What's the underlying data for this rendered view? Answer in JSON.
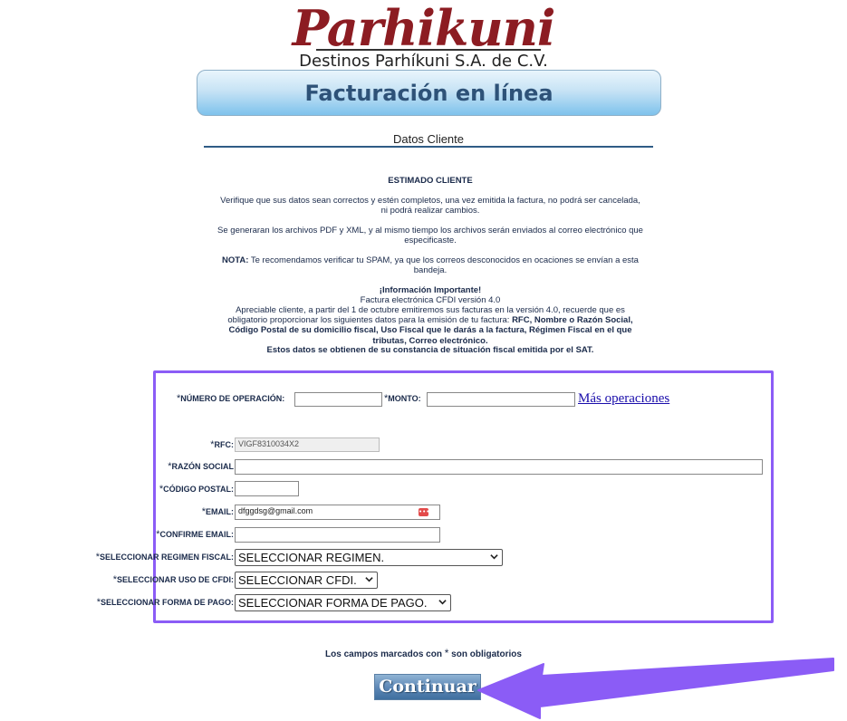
{
  "header": {
    "logo_text": "Parhikuni",
    "company": "Destinos Parhíkuni S.A. de C.V.",
    "banner_title": "Facturación en línea",
    "section_title": "Datos Cliente"
  },
  "info": {
    "heading": "ESTIMADO CLIENTE",
    "p1": "Verifique que sus datos sean correctos y estén completos, una vez emitida la factura, no podrá ser cancelada, ni podrá realizar cambios.",
    "p2": "Se generaran los archivos PDF y XML, y al mismo tiempo los archivos serán enviados al correo electrónico que especificaste.",
    "nota_label": "NOTA:",
    "nota_text": " Te recomendamos verificar tu SPAM, ya que los correos desconocidos en ocaciones se envían a esta bandeja.",
    "important_title": "¡Información Importante!",
    "important_version": "Factura electrónica CFDI versión 4.0",
    "important_intro": "Apreciable cliente, a partir del 1 de octubre emitiremos sus facturas en la versión 4.0, recuerde que es obligatorio proporcionar los siguientes datos para la emisión de tu factura: ",
    "important_fields": "RFC, Nombre o Razón Social, Código Postal de su domicilio fiscal, Uso Fiscal que le darás a la factura, Régimen Fiscal en el que tributas, Correo electrónico.",
    "important_source": "Estos datos se obtienen de su constancia de situación fiscal emitida por el SAT."
  },
  "form": {
    "asterisk": "*",
    "numero_operacion_label": "NÚMERO DE OPERACIÓN:",
    "numero_operacion_value": "",
    "monto_label": "MONTO:",
    "monto_value": "",
    "mas_operaciones": "Más operaciones",
    "rfc_label": "RFC:",
    "rfc_value": "VIGF8310034X2",
    "razon_social_label": "RAZÓN SOCIAL",
    "razon_social_value": "",
    "codigo_postal_label": "CÓDIGO POSTAL:",
    "codigo_postal_value": "",
    "email_label": "EMAIL:",
    "email_value": "dfggdsg@gmail.com",
    "confirme_email_label": "CONFIRME EMAIL:",
    "confirme_email_value": "",
    "regimen_label": "SELECCIONAR REGIMEN FISCAL:",
    "regimen_value": "SELECCIONAR REGIMEN.",
    "uso_cfdi_label": "SELECCIONAR USO DE CFDI:",
    "uso_cfdi_value": "SELECCIONAR CFDI.",
    "forma_pago_label": "SELECCIONAR FORMA DE PAGO:",
    "forma_pago_value": "SELECCIONAR FORMA DE PAGO."
  },
  "footer": {
    "note_prefix": "Los campos marcados con ",
    "note_asterisk": "*",
    "note_suffix": " son obligatorios",
    "continue_label": "Continuar"
  },
  "colors": {
    "highlight": "#8b5cf6",
    "logo": "#8c1c22",
    "banner_text": "#2e5278"
  }
}
